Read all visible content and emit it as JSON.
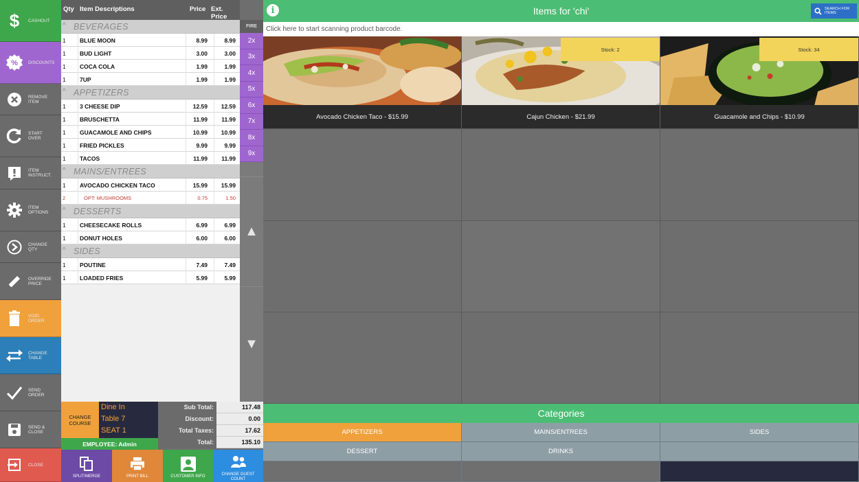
{
  "sidebar": {
    "items": [
      {
        "label": "CASHOUT",
        "color": "#3fa74b",
        "icon": "dollar-icon"
      },
      {
        "label": "DISCOUNTS",
        "color": "#a066cf",
        "icon": "percent-icon"
      },
      {
        "label": "REMOVE\nITEM",
        "color": "#6b6b6b",
        "icon": "remove-circle-icon"
      },
      {
        "label": "START\nOVER",
        "color": "#6b6b6b",
        "icon": "refresh-icon"
      },
      {
        "label": "ITEM\nINSTRUCT.",
        "color": "#6b6b6b",
        "icon": "exclamation-icon"
      },
      {
        "label": "ITEM\nOPTIONS",
        "color": "#6b6b6b",
        "icon": "gear-icon"
      },
      {
        "label": "CHANGE\nQTY",
        "color": "#6b6b6b",
        "icon": "change-qty-icon"
      },
      {
        "label": "OVERRIDE\nPRICE",
        "color": "#6b6b6b",
        "icon": "pencil-icon"
      },
      {
        "label": "VOID\nORDER",
        "color": "#f0a13c",
        "icon": "trash-icon"
      },
      {
        "label": "CHANGE\nTABLE",
        "color": "#2c7fb8",
        "icon": "swap-arrows-icon"
      },
      {
        "label": "SEND\nORDER",
        "color": "#6b6b6b",
        "icon": "checkmark-icon"
      },
      {
        "label": "SEND &\nCLOSE",
        "color": "#6b6b6b",
        "icon": "save-icon"
      },
      {
        "label": "CLOSE",
        "color": "#e05a50",
        "icon": "exit-icon"
      }
    ]
  },
  "order": {
    "headers": {
      "qty": "Qty",
      "desc": "Item Descriptions",
      "price": "Price",
      "ext": "Ext. Price"
    },
    "groups": [
      {
        "name": "BEVERAGES",
        "items": [
          {
            "qty": "1",
            "desc": "BLUE MOON",
            "price": "8.99",
            "ext": "8.99"
          },
          {
            "qty": "1",
            "desc": "BUD LIGHT",
            "price": "3.00",
            "ext": "3.00"
          },
          {
            "qty": "1",
            "desc": "COCA COLA",
            "price": "1.99",
            "ext": "1.99"
          },
          {
            "qty": "1",
            "desc": "7UP",
            "price": "1.99",
            "ext": "1.99"
          }
        ]
      },
      {
        "name": "APPETIZERS",
        "items": [
          {
            "qty": "1",
            "desc": "3 CHEESE DIP",
            "price": "12.59",
            "ext": "12.59"
          },
          {
            "qty": "1",
            "desc": "BRUSCHETTA",
            "price": "11.99",
            "ext": "11.99"
          },
          {
            "qty": "1",
            "desc": "GUACAMOLE AND CHIPS",
            "price": "10.99",
            "ext": "10.99"
          },
          {
            "qty": "1",
            "desc": "FRIED PICKLES",
            "price": "9.99",
            "ext": "9.99"
          },
          {
            "qty": "1",
            "desc": "TACOS",
            "price": "11.99",
            "ext": "11.99"
          }
        ]
      },
      {
        "name": "MAINS/ENTREES",
        "items": [
          {
            "qty": "1",
            "desc": "AVOCADO CHICKEN TACO",
            "price": "15.99",
            "ext": "15.99"
          },
          {
            "qty": "2",
            "desc": "OPT: MUSHROOMS",
            "price": "0.75",
            "ext": "1.50",
            "option": true
          }
        ]
      },
      {
        "name": "DESSERTS",
        "items": [
          {
            "qty": "1",
            "desc": "CHEESECAKE ROLLS",
            "price": "6.99",
            "ext": "6.99"
          },
          {
            "qty": "1",
            "desc": "DONUT HOLES",
            "price": "6.00",
            "ext": "6.00"
          }
        ]
      },
      {
        "name": "SIDES",
        "items": [
          {
            "qty": "1",
            "desc": "POUTINE",
            "price": "7.49",
            "ext": "7.49"
          },
          {
            "qty": "1",
            "desc": "LOADED FRIES",
            "price": "5.99",
            "ext": "5.99"
          }
        ]
      }
    ]
  },
  "qty_column": {
    "fire_label": "FIRE",
    "multipliers": [
      "2x",
      "3x",
      "4x",
      "5x",
      "6x",
      "7x",
      "8x",
      "9x"
    ],
    "up_glyph": "▲",
    "down_glyph": "▼"
  },
  "totals": {
    "change_course": "CHANGE\nCOURSE",
    "dine_in": "Dine In",
    "table": "Table 7",
    "seat": "SEAT 1",
    "employee": "EMPLOYEE: Admin",
    "rows": [
      {
        "label": "Sub Total:",
        "value": "117.48"
      },
      {
        "label": "Discount:",
        "value": "0.00"
      },
      {
        "label": "Total Taxes:",
        "value": "17.62"
      },
      {
        "label": "Total:",
        "value": "135.10"
      }
    ]
  },
  "bottom_buttons": [
    {
      "label": "SPLIT/MERGE",
      "color": "#6c4aa6",
      "icon": "split-merge-icon"
    },
    {
      "label": "PRINT BILL",
      "color": "#e0873a",
      "icon": "printer-icon"
    },
    {
      "label": "CUSTOMER INFO",
      "color": "#3fa74b",
      "icon": "user-icon"
    },
    {
      "label": "CHANGE GUEST\nCOUNT",
      "color": "#2d8de0",
      "icon": "guests-icon"
    }
  ],
  "header": {
    "info_glyph": "i",
    "title": "Items for 'chi'",
    "search_label": "SEARCH FOR\nITEMS",
    "scan_prompt": "Click here to start scanning product barcode."
  },
  "products": [
    {
      "caption": "Avocado Chicken Taco - $15.99",
      "stock": ""
    },
    {
      "caption": "Cajun Chicken - $21.99",
      "stock": "Stock: 2"
    },
    {
      "caption": "Guacamole and Chips - $10.99",
      "stock": "Stock: 34"
    }
  ],
  "categories": {
    "title": "Categories",
    "buttons": [
      {
        "label": "APPETIZERS",
        "color": "#f0a13c"
      },
      {
        "label": "MAINS/ENTREES",
        "color": "#8e9ea5"
      },
      {
        "label": "SIDES",
        "color": "#8e9ea5"
      },
      {
        "label": "DESSERT",
        "color": "#8e9ea5"
      },
      {
        "label": "DRINKS",
        "color": "#8e9ea5"
      },
      {
        "label": "",
        "color": "#8e9ea5"
      }
    ]
  },
  "colors": {
    "accent_green": "#4cbd74",
    "purple": "#a066cf",
    "orange": "#f0a13c",
    "dark_navy": "#272a3e",
    "stock_yellow": "#f2d45a"
  }
}
